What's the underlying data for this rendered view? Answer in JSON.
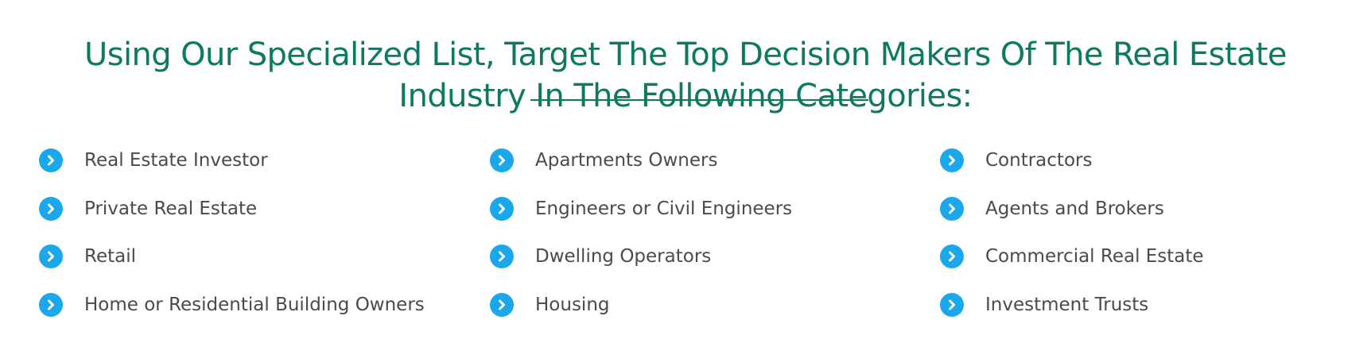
{
  "heading": {
    "line1": "Using Our Specialized List, Target The Top Decision Makers Of The Real Estate",
    "line2": "Industry In The Following Categories:"
  },
  "colors": {
    "heading": "#0d7a5f",
    "icon": "#1ba7ec",
    "text": "#4a4a4a"
  },
  "icon_name": "chevron-right-circle-icon",
  "columns": [
    {
      "items": [
        {
          "label": "Real Estate Investor"
        },
        {
          "label": "Private Real Estate"
        },
        {
          "label": "Retail"
        },
        {
          "label": "Home or Residential Building Owners"
        }
      ]
    },
    {
      "items": [
        {
          "label": "Apartments Owners"
        },
        {
          "label": "Engineers or Civil Engineers"
        },
        {
          "label": "Dwelling Operators"
        },
        {
          "label": "Housing"
        }
      ]
    },
    {
      "items": [
        {
          "label": "Contractors"
        },
        {
          "label": "Agents and Brokers"
        },
        {
          "label": "Commercial Real Estate"
        },
        {
          "label": "Investment Trusts"
        }
      ]
    }
  ]
}
